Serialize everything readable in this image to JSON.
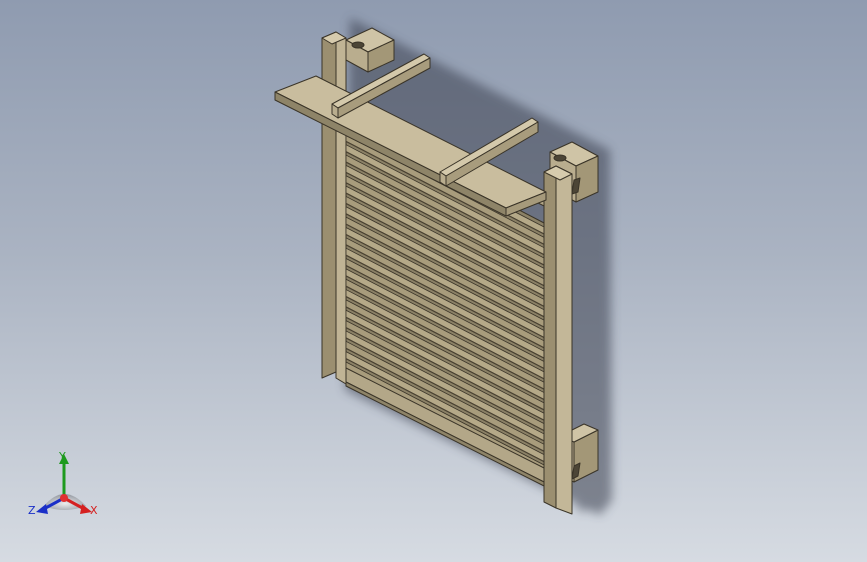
{
  "viewport": {
    "background_top": "#8f9bb0",
    "background_bottom": "#d6dbe2",
    "model_color": "#b7ab8c",
    "model_edge_color": "#3a3428"
  },
  "triad": {
    "x_label": "X",
    "y_label": "Y",
    "z_label": "Z",
    "x_color": "#d52020",
    "y_color": "#1e9a1e",
    "z_color": "#1a2fc8"
  }
}
